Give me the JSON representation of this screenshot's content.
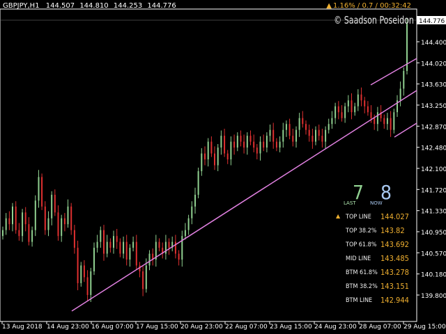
{
  "header": {
    "symbol": "GBPJPY,H1",
    "open": "144.507",
    "high": "144.810",
    "low": "144.253",
    "close": "144.776"
  },
  "status": {
    "arrow": "▲",
    "text": "1.16% / 0.7 / 00:32:42"
  },
  "copyright": "© Saadson Poseidon",
  "colors": {
    "background": "#000000",
    "bull": "#90d090",
    "bear": "#e03030",
    "channel": "#e080e0",
    "axis": "#ffffff",
    "accent": "#f0b030"
  },
  "counter": {
    "last_label": "LAST",
    "last_value": "7",
    "now_label": "NOW",
    "now_value": "8"
  },
  "levels": [
    {
      "marker": "▲",
      "name": "TOP LINE",
      "value": "144.027"
    },
    {
      "marker": "",
      "name": "TOP 38.2%",
      "value": "143.82"
    },
    {
      "marker": "",
      "name": "TOP 61.8%",
      "value": "143.692"
    },
    {
      "marker": "",
      "name": "MID LINE",
      "value": "143.485"
    },
    {
      "marker": "",
      "name": "BTM 61.8%",
      "value": "143.278"
    },
    {
      "marker": "",
      "name": "BTM 38.2%",
      "value": "143.151"
    },
    {
      "marker": "",
      "name": "BTM LINE",
      "value": "142.944"
    }
  ],
  "chart_data": {
    "type": "candlestick",
    "ylim": [
      139.65,
      144.95
    ],
    "y_ticks": [
      "144.400",
      "144.020",
      "143.630",
      "143.250",
      "142.870",
      "142.480",
      "142.100",
      "141.720",
      "141.330",
      "140.950",
      "140.570",
      "140.180",
      "139.800"
    ],
    "current_price": "144.776",
    "x_tick_labels": [
      "13 Aug 2018",
      "14 Aug 23:00",
      "16 Aug 07:00",
      "17 Aug 15:00",
      "20 Aug 23:00",
      "22 Aug 07:00",
      "23 Aug 15:00",
      "24 Aug 23:00",
      "28 Aug 07:00",
      "29 Aug 15:00"
    ],
    "closes": [
      141.2,
      141.4,
      141.3,
      141.6,
      141.2,
      141.1,
      141.5,
      141.3,
      141.0,
      141.2,
      141.7,
      142.1,
      141.6,
      141.2,
      141.4,
      141.8,
      141.5,
      141.1,
      141.4,
      141.3,
      141.6,
      141.2,
      140.9,
      140.3,
      140.6,
      140.4,
      140.1,
      140.5,
      140.9,
      141.0,
      141.2,
      140.8,
      141.0,
      140.9,
      141.1,
      141.0,
      140.8,
      141.0,
      140.7,
      140.9,
      141.0,
      140.6,
      140.5,
      140.2,
      140.6,
      140.8,
      140.7,
      141.0,
      140.9,
      140.8,
      141.0,
      140.9,
      141.0,
      140.8,
      140.7,
      141.1,
      141.2,
      141.4,
      141.6,
      141.8,
      142.2,
      142.5,
      142.4,
      142.7,
      142.5,
      142.3,
      142.6,
      142.8,
      142.5,
      142.4,
      142.7,
      142.6,
      142.8,
      142.7,
      142.6,
      142.8,
      142.7,
      142.6,
      142.5,
      142.7,
      142.6,
      142.8,
      142.9,
      142.7,
      142.6,
      142.7,
      142.9,
      143.0,
      142.8,
      142.7,
      142.9,
      143.1,
      143.0,
      142.9,
      142.8,
      142.7,
      142.9,
      142.8,
      142.7,
      142.9,
      143.0,
      143.1,
      143.3,
      143.2,
      143.1,
      143.3,
      143.4,
      143.2,
      143.3,
      143.5,
      143.4,
      143.3,
      143.2,
      143.1,
      143.0,
      143.2,
      143.1,
      143.0,
      143.1,
      142.9,
      143.2,
      143.4,
      143.6,
      143.9,
      144.7
    ]
  }
}
